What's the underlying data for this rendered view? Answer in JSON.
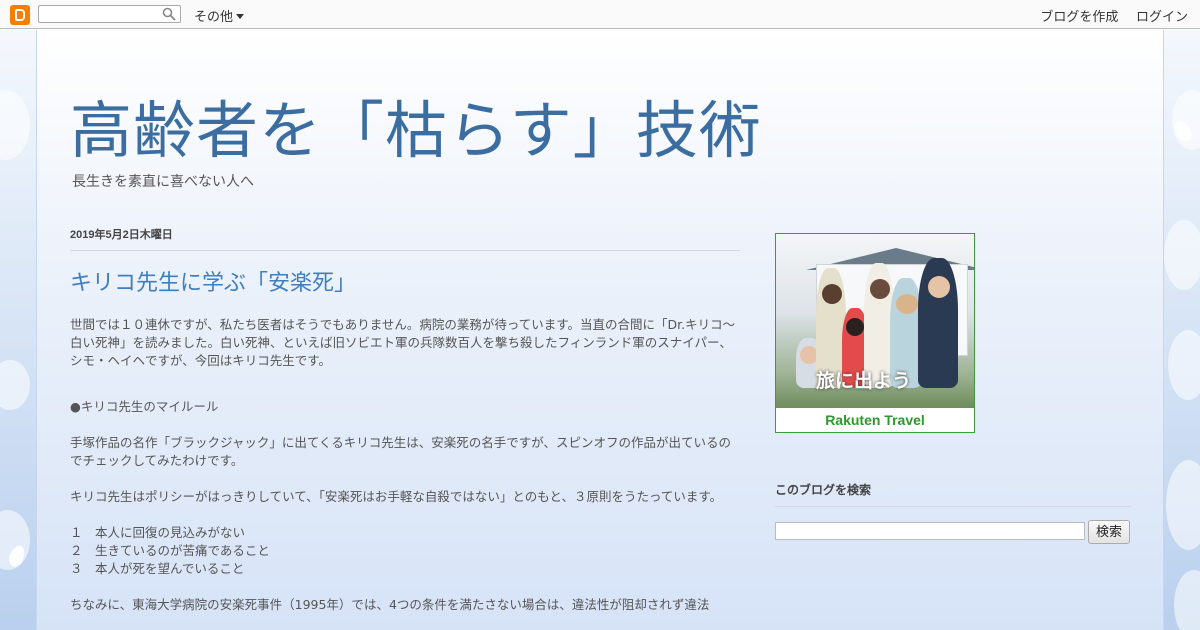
{
  "navbar": {
    "more_label": "その他",
    "create_blog": "ブログを作成",
    "login": "ログイン"
  },
  "header": {
    "title": "高齢者を「枯らす」技術",
    "description": "長生きを素直に喜べない人へ"
  },
  "post": {
    "date": "2019年5月2日木曜日",
    "title": "キリコ先生に学ぶ「安楽死」",
    "paragraphs": [
      "世間では１０連休ですが、私たち医者はそうでもありません。病院の業務が待っています。当直の合間に「Dr.キリコ～白い死神」を読みました。白い死神、といえば旧ソビエト軍の兵隊数百人を撃ち殺したフィンランド軍のスナイパー、シモ・ヘイヘですが、今回はキリコ先生です。",
      "●キリコ先生のマイルール",
      "手塚作品の名作「ブラックジャック」に出てくるキリコ先生は、安楽死の名手ですが、スピンオフの作品が出ているのでチェックしてみたわけです。",
      "キリコ先生はポリシーがはっきりしていて、「安楽死はお手軽な自殺ではない」とのもと、３原則をうたっています。",
      "１　本人に回復の見込みがない",
      "２　生きているのが苦痛であること",
      "３　本人が死を望んでいること",
      "ちなみに、東海大学病院の安楽死事件（1995年）では、4つの条件を満たさない場合は、違法性が阻却されず違法"
    ]
  },
  "sidebar": {
    "ad_text": "旅に出よう",
    "ad_brand": "Rakuten Travel",
    "search_title": "このブログを検索",
    "search_button": "検索"
  },
  "colors": {
    "title": "#3c6da1",
    "post_title": "#3e7fc0",
    "blogger_orange": "#f57d00",
    "rakuten_green": "#2a9a2a"
  }
}
